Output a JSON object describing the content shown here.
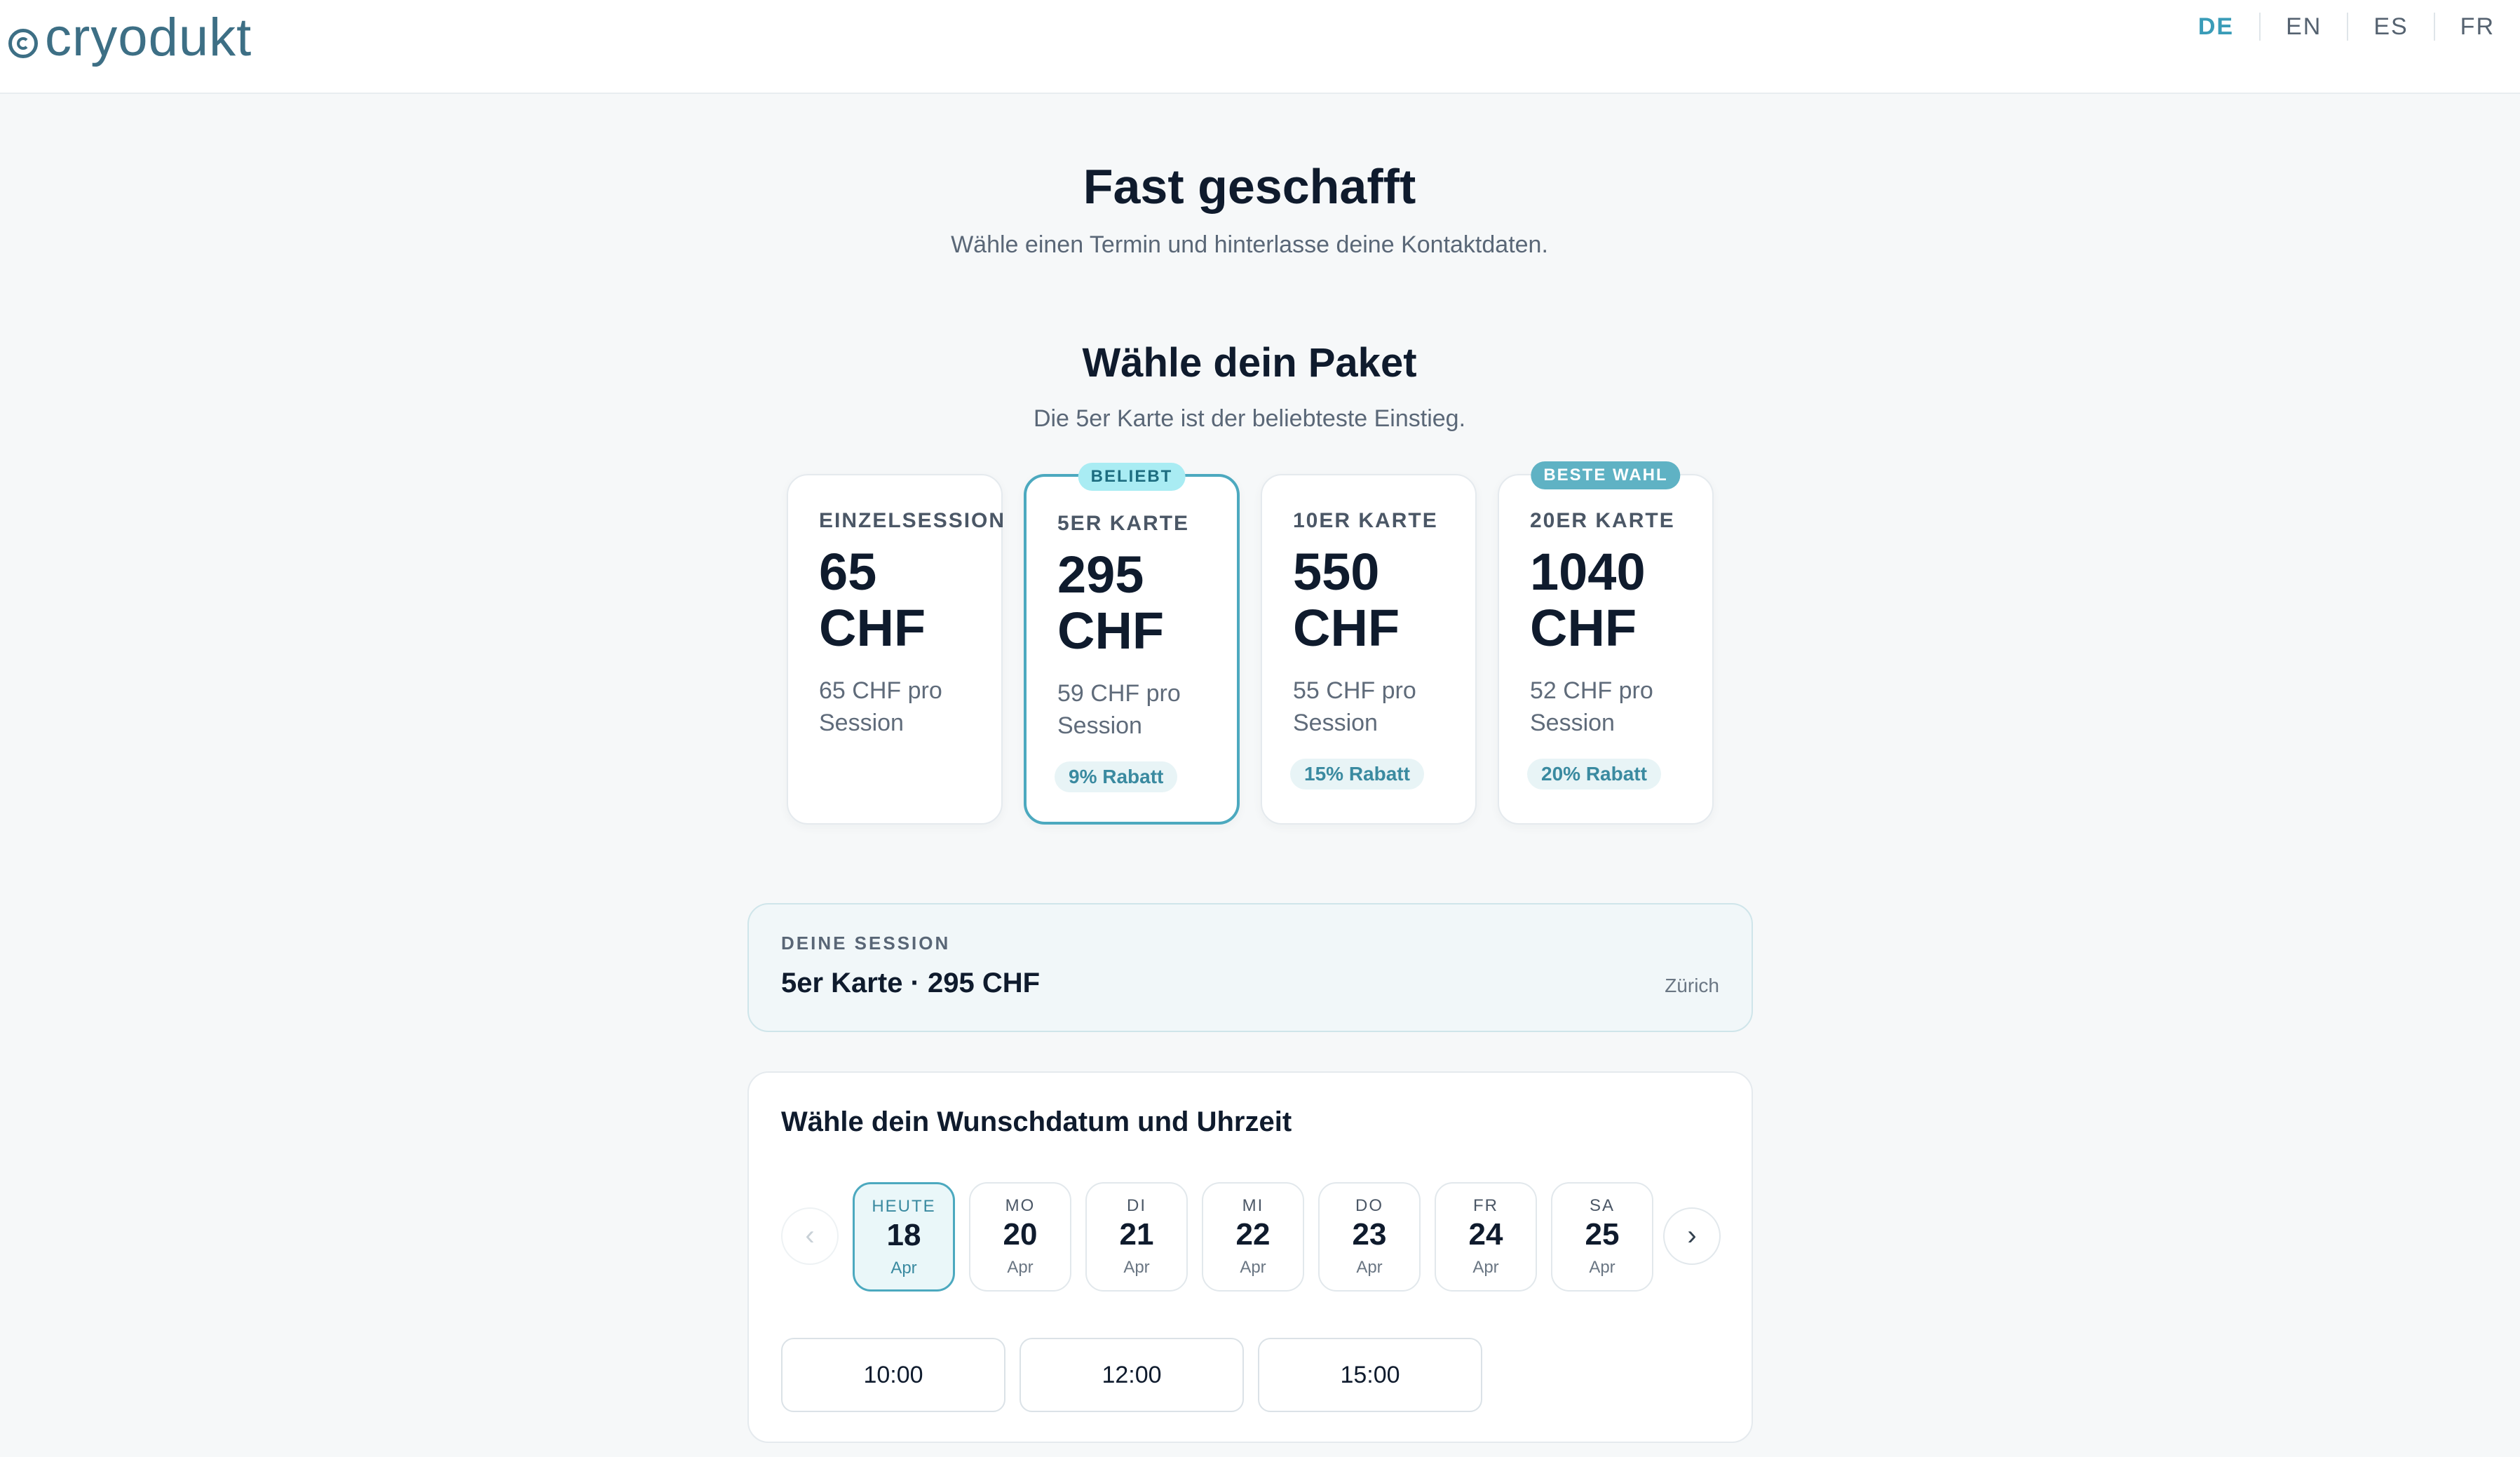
{
  "header": {
    "logo_text": "cryodukt",
    "languages": [
      "DE",
      "EN",
      "ES",
      "FR"
    ],
    "active_language": "DE"
  },
  "hero": {
    "title": "Fast geschafft",
    "subtitle": "Wähle einen Termin und hinterlasse deine Kontaktdaten."
  },
  "packages": {
    "title": "Wähle dein Paket",
    "subtitle": "Die 5er Karte ist der beliebteste Einstieg.",
    "cards": [
      {
        "name": "EINZELSESSION",
        "price_line1": "65",
        "price_line2": "CHF",
        "per_line1": "65 CHF pro",
        "per_line2": "Session",
        "discount": "",
        "badge": ""
      },
      {
        "name": "5ER KARTE",
        "price_line1": "295",
        "price_line2": "CHF",
        "per_line1": "59 CHF pro",
        "per_line2": "Session",
        "discount": "9% Rabatt",
        "badge": "BELIEBT"
      },
      {
        "name": "10ER KARTE",
        "price_line1": "550",
        "price_line2": "CHF",
        "per_line1": "55 CHF pro",
        "per_line2": "Session",
        "discount": "15% Rabatt",
        "badge": ""
      },
      {
        "name": "20ER KARTE",
        "price_line1": "1040",
        "price_line2": "CHF",
        "per_line1": "52 CHF pro",
        "per_line2": "Session",
        "discount": "20% Rabatt",
        "badge": "BESTE WAHL"
      }
    ],
    "selected": "5ER KARTE"
  },
  "session": {
    "label": "DEINE SESSION",
    "value": "5er Karte · 295 CHF",
    "location": "Zürich"
  },
  "schedule": {
    "title": "Wähle dein Wunschdatum und Uhrzeit",
    "days": [
      {
        "weekday": "HEUTE",
        "day": "18",
        "month": "Apr"
      },
      {
        "weekday": "MO",
        "day": "20",
        "month": "Apr"
      },
      {
        "weekday": "DI",
        "day": "21",
        "month": "Apr"
      },
      {
        "weekday": "MI",
        "day": "22",
        "month": "Apr"
      },
      {
        "weekday": "DO",
        "day": "23",
        "month": "Apr"
      },
      {
        "weekday": "FR",
        "day": "24",
        "month": "Apr"
      },
      {
        "weekday": "SA",
        "day": "25",
        "month": "Apr"
      }
    ],
    "selected_day": "18",
    "times": [
      "10:00",
      "12:00",
      "15:00"
    ],
    "prev_icon": "chevron-left-icon",
    "next_icon": "chevron-right-icon"
  },
  "colors": {
    "accent": "#4ca9bf",
    "brand": "#3d6f85",
    "text": "#0f1b2d"
  }
}
